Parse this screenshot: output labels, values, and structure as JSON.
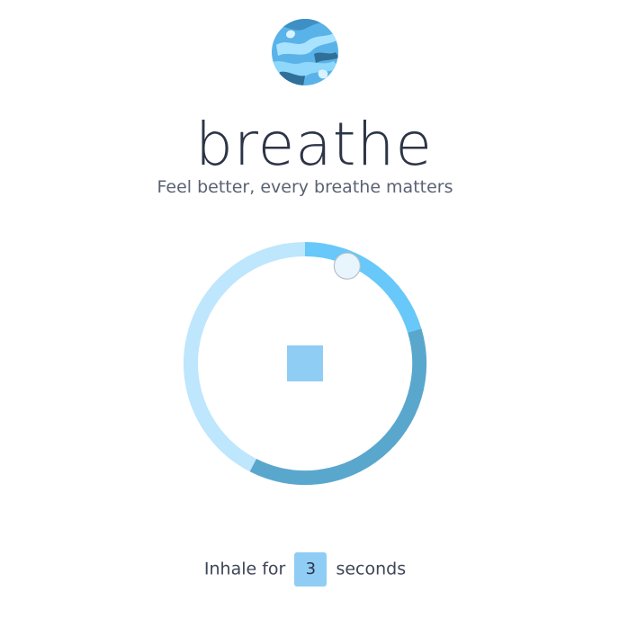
{
  "app": {
    "title": "breathe",
    "subtitle": "Feel better, every breathe matters"
  },
  "logo": {
    "icon": "earth-globe-icon"
  },
  "breath_ring": {
    "progress": 0.065,
    "phase_colors": {
      "inhale": "#67c8f9",
      "hold": "#5aa7ce",
      "exhale": "#bee6fd"
    },
    "indicator_color": "#e8f5fd",
    "center_color": "#90cdf4"
  },
  "footer": {
    "prefix": "Inhale for",
    "seconds": "3",
    "suffix": "seconds"
  }
}
